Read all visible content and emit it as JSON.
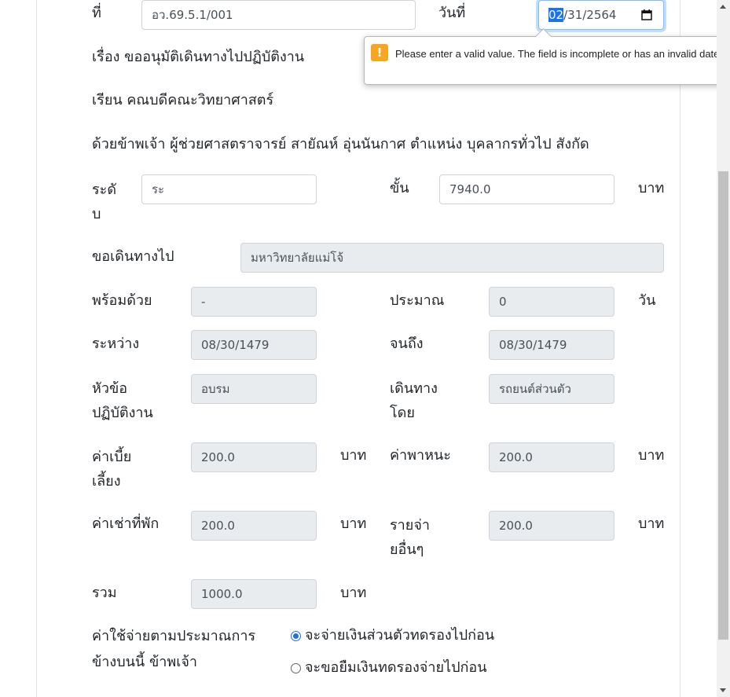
{
  "header": {
    "no_label": "ที่",
    "no_value": "อว.69.5.1/001",
    "date_label": "วันที่",
    "date_month": "02",
    "date_rest": "/31/2564"
  },
  "validation": {
    "message": "Please enter a valid value. The field is incomplete or has an invalid date.",
    "icon": "!"
  },
  "letter": {
    "subject": "เรื่อง ขออนุมัติเดินทางไปปฏิบัติงาน",
    "to": "เรียน คณบดีคณะวิทยาศาสตร์",
    "intro": "ด้วยข้าพเจ้า ผู้ช่วยศาสตราจารย์ สายัณห์ อุ่นนันกาศ ตำแหน่ง บุคลากรทั่วไป สังกัด"
  },
  "fields": {
    "level_label_1": "ระดั",
    "level_label_2": "บ",
    "level_value": "ระ",
    "step_label": "ขั้น",
    "step_value": "7940.0",
    "step_unit": "บาท",
    "destination_label": "ขอเดินทางไป",
    "destination_value": "มหาวิทยาลัยแม่โจ้",
    "companion_label": "พร้อมด้วย",
    "companion_value": "-",
    "approx_label": "ประมาณ",
    "approx_value": "0",
    "approx_unit": "วัน",
    "between_label": "ระหว่าง",
    "between_value": "08/30/1479",
    "until_label": "จนถึง",
    "until_value": "08/30/1479",
    "topic_label_1": "หัวข้อ",
    "topic_label_2": "ปฏิบัติงาน",
    "topic_value": "อบรม",
    "travel_label_1": "เดินทาง",
    "travel_label_2": "โดย",
    "travel_value": "รถยนต์ส่วนตัว",
    "allowance_label_1": "ค่าเบี้ย",
    "allowance_label_2": "เลี้ยง",
    "allowance_value": "200.0",
    "allowance_unit": "บาท",
    "vehicle_label": "ค่าพาหนะ",
    "vehicle_value": "200.0",
    "vehicle_unit": "บาท",
    "lodging_label": "ค่าเช่าที่พัก",
    "lodging_value": "200.0",
    "lodging_unit": "บาท",
    "other_label_1": "รายจ่า",
    "other_label_2": "ยอื่นๆ",
    "other_value": "200.0",
    "other_unit": "บาท",
    "total_label": "รวม",
    "total_value": "1000.0",
    "total_unit": "บาท"
  },
  "payment": {
    "label_1": "ค่าใช้จ่ายตามประมาณการ",
    "label_2": "ข้างบนนี้ ข้าพเจ้า",
    "options": [
      {
        "label": "จะจ่ายเงินส่วนตัวทดรองไปก่อน",
        "selected": true
      },
      {
        "label": "จะขอยืมเงินทดรองจ่ายไปก่อน",
        "selected": false
      }
    ]
  },
  "colors": {
    "focus": "#80bdff",
    "selection": "#1a73e8",
    "warning": "#f5a623",
    "readonly_bg": "#e9ecef"
  },
  "icons": {
    "date": "calendar-icon",
    "validation": "warning-icon"
  }
}
